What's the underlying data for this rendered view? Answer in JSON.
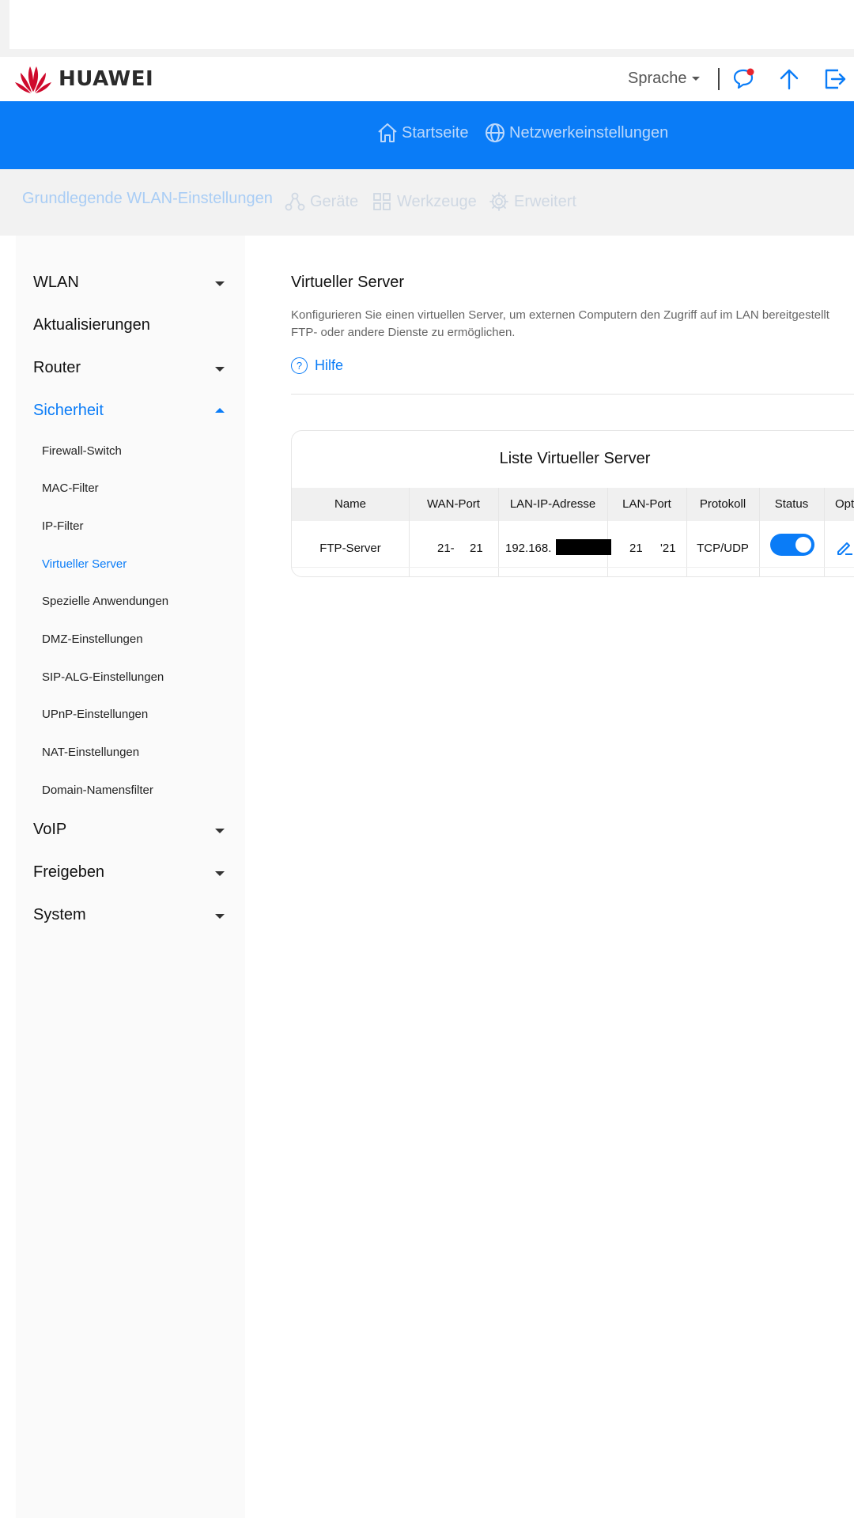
{
  "header": {
    "brand": "HUAWEI",
    "language_label": "Sprache",
    "brand_color": "#cf0a2c",
    "icons": [
      "messages-icon",
      "upload-icon",
      "logout-icon"
    ]
  },
  "nav": {
    "items": [
      {
        "label": "Startseite",
        "icon": "home-icon"
      },
      {
        "label": "Netzwerkeinstellungen",
        "icon": "globe-icon"
      }
    ],
    "accent": "#0a7cf7"
  },
  "subnav": {
    "items": [
      {
        "label": "Grundlegende WLAN-Einstellungen"
      },
      {
        "label": "Geräte",
        "icon": "devices-icon"
      },
      {
        "label": "Werkzeuge",
        "icon": "tools-icon"
      },
      {
        "label": "Erweitert",
        "icon": "gear-icon"
      }
    ]
  },
  "sidebar": {
    "sections": [
      {
        "label": "WLAN"
      },
      {
        "label": "Aktualisierungen"
      },
      {
        "label": "Router"
      },
      {
        "label": "Sicherheit"
      },
      {
        "label": "VoIP"
      },
      {
        "label": "Freigeben"
      },
      {
        "label": "System"
      }
    ],
    "security_items": [
      "Firewall-Switch",
      "MAC-Filter",
      "IP-Filter",
      "Virtueller Server",
      "Spezielle Anwendungen",
      "DMZ-Einstellungen",
      "SIP-ALG-Einstellungen",
      "UPnP-Einstellungen",
      "NAT-Einstellungen",
      "Domain-Namensfilter"
    ]
  },
  "main": {
    "title": "Virtueller Server",
    "description_line1": "Konfigurieren Sie einen virtuellen Server, um externen Computern den Zugriff auf im LAN bereitgestellt",
    "description_line2": "FTP- oder andere Dienste zu ermöglichen.",
    "help_label": "Hilfe",
    "table": {
      "title": "Liste Virtueller Server",
      "columns": [
        "Name",
        "WAN-Port",
        "LAN-IP-Adresse",
        "LAN-Port",
        "Protokoll",
        "Status",
        "Opt"
      ],
      "rows": [
        {
          "name": "FTP-Server",
          "wan_port_start": "21-",
          "wan_port_end": "21",
          "lan_ip": "192.168.",
          "lan_port_start": "21",
          "lan_port_end": "'21",
          "protocol": "TCP/UDP",
          "status_on": true
        }
      ]
    }
  }
}
